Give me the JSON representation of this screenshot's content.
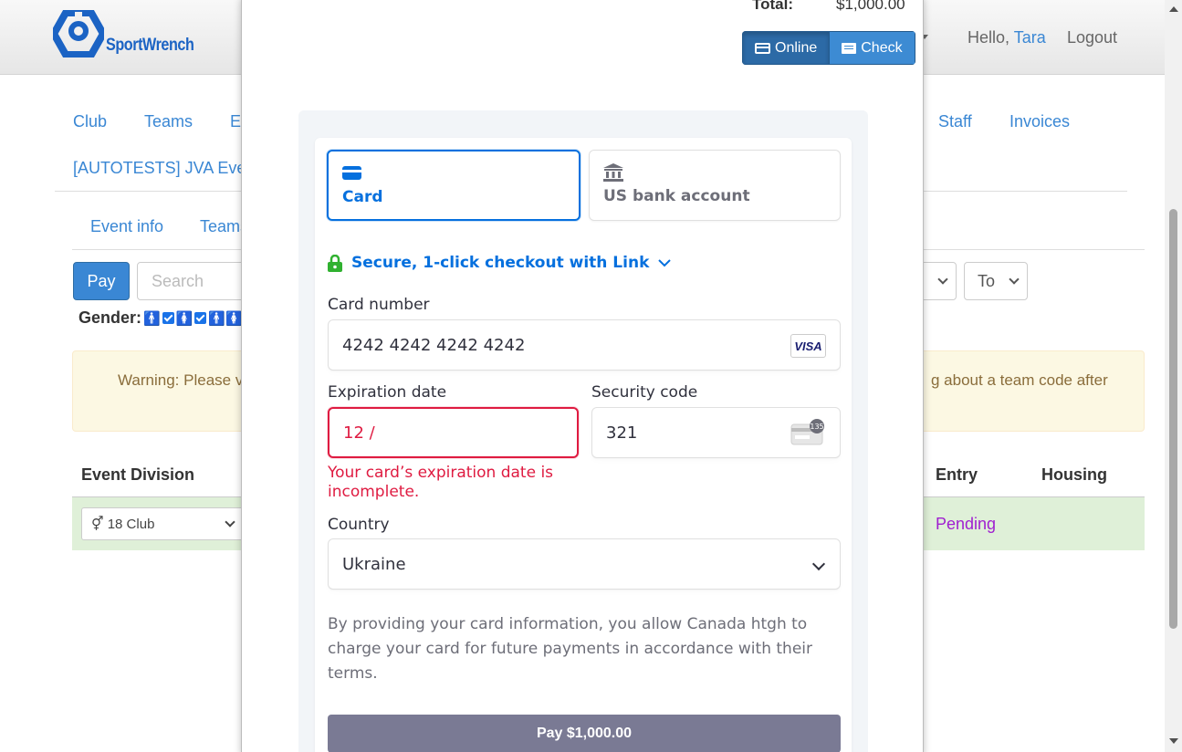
{
  "app": {
    "brand": "SportWrench",
    "user_menu_caret_text": "t",
    "greeting": "Hello,",
    "user_name": "Tara",
    "logout": "Logout"
  },
  "nav_main": [
    "Club",
    "Teams",
    "E",
    "Staff",
    "Invoices"
  ],
  "event_title": "[AUTOTESTS] JVA Eve",
  "nav_event": [
    "Event info",
    "Teams"
  ],
  "toolbar": {
    "pay_label": "Pay",
    "search_placeholder": "Search",
    "to_label": "To"
  },
  "gender_label": "Gender:",
  "warning": {
    "left_text": "Warning: Please v",
    "right_text": "g about a team code after"
  },
  "table": {
    "headers": {
      "division": "Event Division",
      "entry": "Entry",
      "housing": "Housing"
    },
    "row": {
      "division_value": "⚥ 18 Club",
      "entry_status": "Pending"
    }
  },
  "modal": {
    "total_label": "Total:",
    "total_value": "$1,000.00",
    "methods": {
      "online": "Online",
      "check": "Check"
    },
    "tabs": {
      "card": "Card",
      "bank": "US bank account"
    },
    "link_text": "Secure, 1-click checkout with Link",
    "card_number": {
      "label": "Card number",
      "value": "4242 4242 4242 4242",
      "brand": "VISA"
    },
    "expiration": {
      "label": "Expiration date",
      "value": "12 /",
      "error": "Your card’s expiration date is incomplete."
    },
    "security": {
      "label": "Security code",
      "value": "321",
      "hint": "135"
    },
    "country": {
      "label": "Country",
      "value": "Ukraine"
    },
    "terms": "By providing your card information, you allow Canada htgh to charge your card for future payments in accordance with their terms.",
    "pay_button": "Pay $1,000.00"
  },
  "colors": {
    "stripe_accent": "#0570de",
    "error": "#df1b41",
    "app_link": "#3a87d4",
    "pay_button_disabled": "#7a7a94"
  }
}
